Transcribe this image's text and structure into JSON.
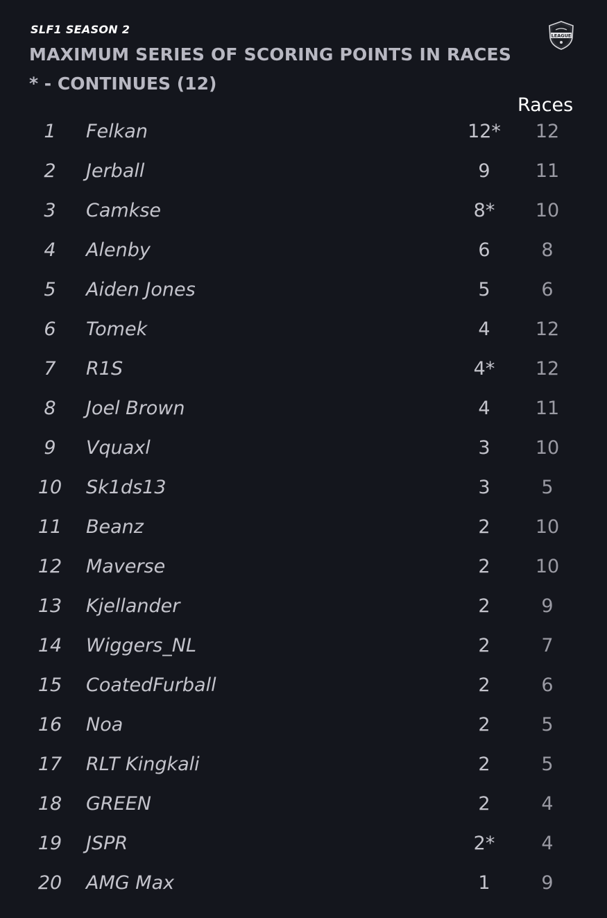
{
  "header": {
    "season": "SLF1 SEASON 2",
    "title": "MAXIMUM SERIES OF SCORING POINTS IN RACES",
    "subtitle": "* - CONTINUES (12)",
    "races_label": "Races",
    "logo_icon": "shield-logo-icon",
    "logo_text": "LEAGUE"
  },
  "rows": [
    {
      "pos": "1",
      "name": "Felkan",
      "streak": "12*",
      "races": "12"
    },
    {
      "pos": "2",
      "name": "Jerball",
      "streak": "9",
      "races": "11"
    },
    {
      "pos": "3",
      "name": "Camkse",
      "streak": "8*",
      "races": "10"
    },
    {
      "pos": "4",
      "name": "Alenby",
      "streak": "6",
      "races": "8"
    },
    {
      "pos": "5",
      "name": "Aiden Jones",
      "streak": "5",
      "races": "6"
    },
    {
      "pos": "6",
      "name": "Tomek",
      "streak": "4",
      "races": "12"
    },
    {
      "pos": "7",
      "name": "R1S",
      "streak": "4*",
      "races": "12"
    },
    {
      "pos": "8",
      "name": "Joel Brown",
      "streak": "4",
      "races": "11"
    },
    {
      "pos": "9",
      "name": "Vquaxl",
      "streak": "3",
      "races": "10"
    },
    {
      "pos": "10",
      "name": "Sk1ds13",
      "streak": "3",
      "races": "5"
    },
    {
      "pos": "11",
      "name": "Beanz",
      "streak": "2",
      "races": "10"
    },
    {
      "pos": "12",
      "name": "Maverse",
      "streak": "2",
      "races": "10"
    },
    {
      "pos": "13",
      "name": "Kjellander",
      "streak": "2",
      "races": "9"
    },
    {
      "pos": "14",
      "name": "Wiggers_NL",
      "streak": "2",
      "races": "7"
    },
    {
      "pos": "15",
      "name": "CoatedFurball",
      "streak": "2",
      "races": "6"
    },
    {
      "pos": "16",
      "name": "Noa",
      "streak": "2",
      "races": "5"
    },
    {
      "pos": "17",
      "name": "RLT Kingkali",
      "streak": "2",
      "races": "5"
    },
    {
      "pos": "18",
      "name": "GREEN",
      "streak": "2",
      "races": "4"
    },
    {
      "pos": "19",
      "name": "JSPR",
      "streak": "2*",
      "races": "4"
    },
    {
      "pos": "20",
      "name": "AMG Max",
      "streak": "1",
      "races": "9"
    }
  ],
  "colors": {
    "background": "#14161d",
    "heading": "#b8b8c2",
    "text": "#c4c4cc",
    "muted": "#9a9aa3",
    "white": "#ffffff"
  }
}
